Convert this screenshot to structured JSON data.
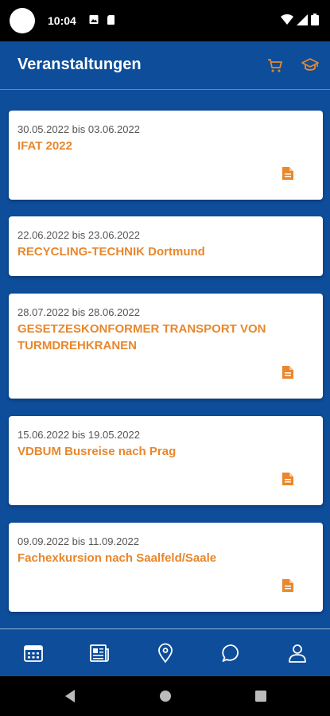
{
  "status_bar": {
    "time": "10:04"
  },
  "header": {
    "title": "Veranstaltungen"
  },
  "events": [
    {
      "date": "30.05.2022 bis 03.06.2022",
      "title": "IFAT 2022"
    },
    {
      "date": "22.06.2022 bis 23.06.2022",
      "title": "RECYCLING-TECHNIK Dortmund"
    },
    {
      "date": "28.07.2022 bis 28.06.2022",
      "title": "GESETZESKONFORMER TRANSPORT VON TURMDREHKRANEN"
    },
    {
      "date": "15.06.2022 bis 19.05.2022",
      "title": "VDBUM Busreise nach Prag"
    },
    {
      "date": "09.09.2022 bis 11.09.2022",
      "title": "Fachexkursion nach Saalfeld/Saale"
    }
  ],
  "colors": {
    "primary": "#0d4d9a",
    "accent": "#e8872d"
  },
  "icons": {
    "header": [
      "cart-icon",
      "graduation-cap-icon"
    ],
    "bottom_nav": [
      "calendar-icon",
      "newspaper-icon",
      "location-pin-icon",
      "chat-bubble-icon",
      "user-icon"
    ]
  }
}
